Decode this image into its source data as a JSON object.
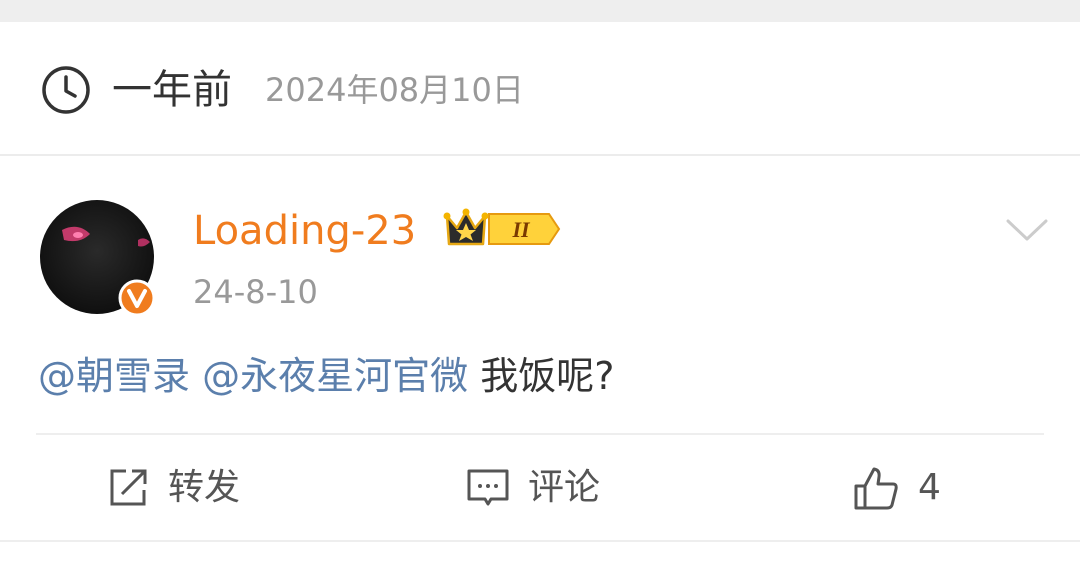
{
  "time_header": {
    "relative_time": "一年前",
    "absolute_date": "2024年08月10日",
    "icon": "clock-icon"
  },
  "post": {
    "author": {
      "name": "Loading-23",
      "avatar_icon": "cat-eyes-avatar",
      "verified_icon": "orange-v-badge",
      "vip_badge_text": "II",
      "name_color": "#f07c1e"
    },
    "time": "24-8-10",
    "text": {
      "mention_1": "@朝雪录",
      "mention_2": "@永夜星河官微",
      "body": "我饭呢?"
    },
    "mention_color": "#5b7fac"
  },
  "actions": {
    "repost_label": "转发",
    "comment_label": "评论",
    "like_count": "4"
  }
}
